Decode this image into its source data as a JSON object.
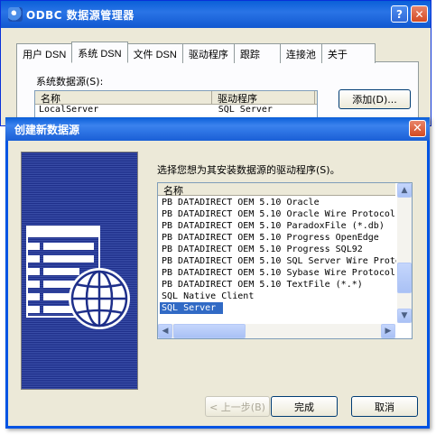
{
  "back_window": {
    "title": "ODBC 数据源管理器",
    "help_label": "?",
    "close_label": "✕",
    "tabs": [
      {
        "label": "用户 DSN"
      },
      {
        "label": "系统 DSN"
      },
      {
        "label": "文件 DSN"
      },
      {
        "label": "驱动程序"
      },
      {
        "label": "跟踪"
      },
      {
        "label": "连接池"
      },
      {
        "label": "关于"
      }
    ],
    "section_label": "系统数据源(S):",
    "columns": {
      "name": "名称",
      "driver": "驱动程序"
    },
    "rows": [
      {
        "name": "LocalServer",
        "driver": "SQL Server"
      }
    ],
    "add_button": "添加(D)..."
  },
  "dialog": {
    "title": "创建新数据源",
    "close_label": "✕",
    "instruction": "选择您想为其安装数据源的驱动程序(S)。",
    "list_header": "名称",
    "drivers": [
      "PB DATADIRECT OEM 5.10 Oracle",
      "PB DATADIRECT OEM 5.10 Oracle Wire Protocol",
      "PB DATADIRECT OEM 5.10 ParadoxFile (*.db)",
      "PB DATADIRECT OEM 5.10 Progress OpenEdge",
      "PB DATADIRECT OEM 5.10 Progress SQL92",
      "PB DATADIRECT OEM 5.10 SQL Server Wire Protocol",
      "PB DATADIRECT OEM 5.10 Sybase Wire Protocol",
      "PB DATADIRECT OEM 5.10 TextFile (*.*)",
      "SQL Native Client",
      "SQL Server"
    ],
    "selected_driver": "SQL Server",
    "buttons": {
      "back": "< 上一步(B)",
      "finish": "完成",
      "cancel": "取消"
    }
  },
  "colors": {
    "titlebar": "#0a5fd8",
    "selection": "#316ac5",
    "dialog_bg": "#ece9d8"
  }
}
